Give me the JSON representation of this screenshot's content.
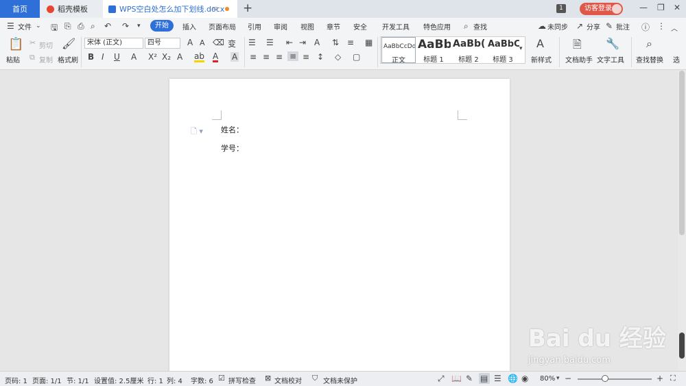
{
  "titlebar": {
    "tabs": [
      {
        "label": "首页"
      },
      {
        "label": "稻壳模板"
      },
      {
        "label": "WPS空白处怎么加下划线.docx"
      }
    ],
    "add_tab": "+",
    "count_badge": "1",
    "login_label": "访客登录",
    "window_buttons": [
      "—",
      "❐",
      "✕"
    ]
  },
  "menubar": {
    "file_label": "文件",
    "items": [
      "开始",
      "插入",
      "页面布局",
      "引用",
      "审阅",
      "视图",
      "章节",
      "安全",
      "开发工具",
      "特色应用"
    ],
    "search_label": "查找",
    "sync_label": "未同步",
    "share_label": "分享",
    "annotate_label": "批注"
  },
  "ribbon": {
    "paste_label": "粘贴",
    "cut_label": "剪切",
    "copy_label": "复制",
    "format_painter_label": "格式刷",
    "font_name": "宋体 (正文)",
    "font_size": "四号",
    "styles": [
      {
        "sample": "AaBbCcDd",
        "label": "正文"
      },
      {
        "sample": "AaBb",
        "label": "标题 1"
      },
      {
        "sample": "AaBb(",
        "label": "标题 2"
      },
      {
        "sample": "AaBbC",
        "label": "标题 3"
      }
    ],
    "new_style_label": "新样式",
    "doc_assistant_label": "文档助手",
    "text_tools_label": "文字工具",
    "find_replace_label": "查找替换",
    "select_label": "选"
  },
  "document": {
    "lines": [
      "姓名：",
      "学号："
    ]
  },
  "statusbar": {
    "page_num": "页码: 1",
    "pages": "页面: 1/1",
    "section": "节: 1/1",
    "setting": "设置值: 2.5厘米",
    "row": "行: 1",
    "col": "列: 4",
    "word_count": "字数: 6",
    "spell_check": "拼写检查",
    "doc_proof": "文档校对",
    "doc_protect": "文档未保护",
    "zoom": "80%"
  },
  "watermark": {
    "logo_text": "Bai du 经验",
    "url": "jingyan.baidu.com"
  }
}
